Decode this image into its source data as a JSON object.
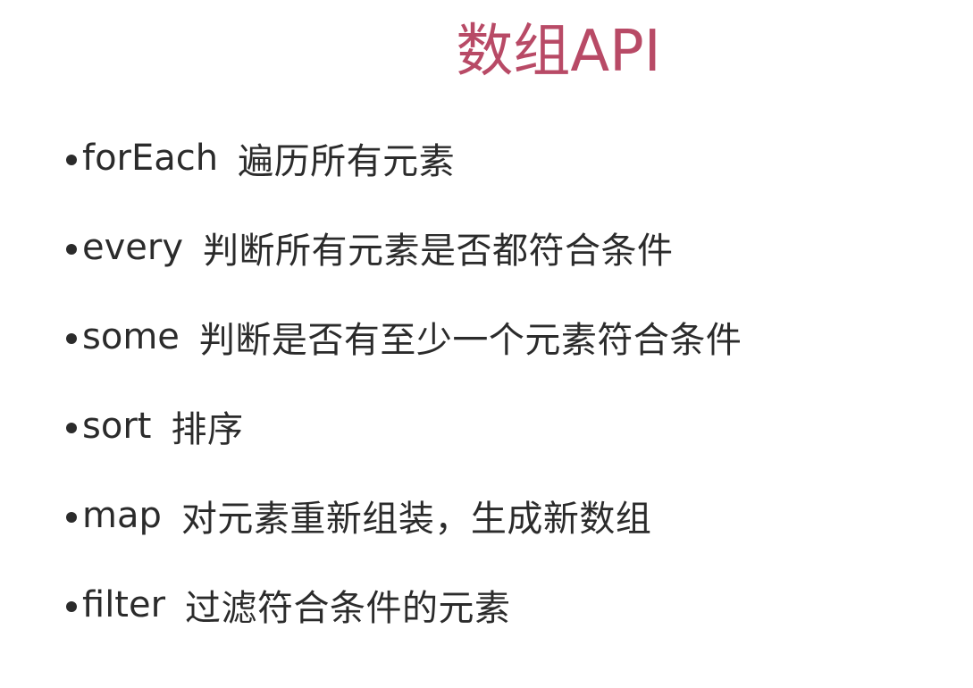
{
  "title": "数组API",
  "colors": {
    "title": "#b84a66",
    "text": "#2b2b2b",
    "background": "#ffffff"
  },
  "items": [
    {
      "api": "forEach",
      "desc": "遍历所有元素"
    },
    {
      "api": "every",
      "desc": "判断所有元素是否都符合条件"
    },
    {
      "api": "some",
      "desc": "判断是否有至少一个元素符合条件"
    },
    {
      "api": "sort",
      "desc": "排序"
    },
    {
      "api": "map",
      "desc": "对元素重新组装，生成新数组"
    },
    {
      "api": "filter",
      "desc": "过滤符合条件的元素"
    }
  ]
}
